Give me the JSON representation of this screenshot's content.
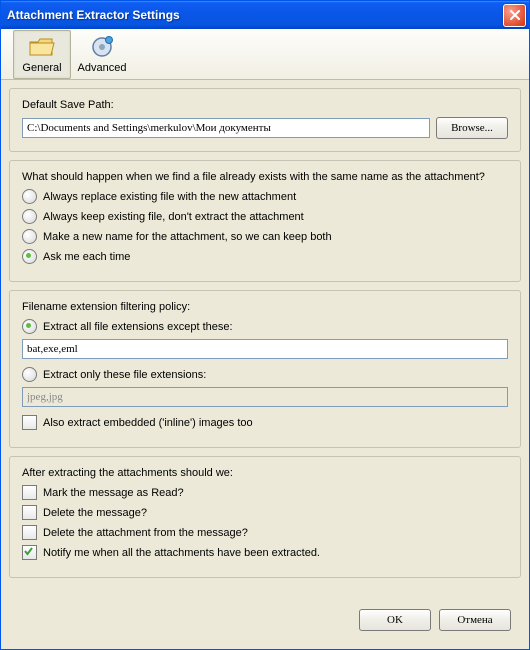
{
  "title": "Attachment Extractor Settings",
  "toolbar": {
    "general": "General",
    "advanced": "Advanced"
  },
  "save_path": {
    "label": "Default Save Path:",
    "value": "C:\\Documents and Settings\\merkulov\\Мои документы",
    "browse": "Browse..."
  },
  "overwrite": {
    "question": "What should happen when we find a file already exists with the same name as the attachment?",
    "o1": "Always replace existing file with the new attachment",
    "o2": "Always keep existing file, don't extract the attachment",
    "o3": "Make a new name for the attachment, so we can keep both",
    "o4": "Ask me each time"
  },
  "filter": {
    "title": "Filename extension filtering policy:",
    "except": "Extract all file extensions except these:",
    "except_value": "bat,exe,eml",
    "only": "Extract only these file extensions:",
    "only_value": "jpeg,jpg",
    "inline": "Also extract embedded ('inline') images too"
  },
  "after": {
    "title": "After extracting the attachments should we:",
    "c1": "Mark the message as Read?",
    "c2": "Delete the message?",
    "c3": "Delete the attachment from the message?",
    "c4": "Notify me when all the attachments have been extracted."
  },
  "buttons": {
    "ok": "OK",
    "cancel": "Отмена"
  }
}
